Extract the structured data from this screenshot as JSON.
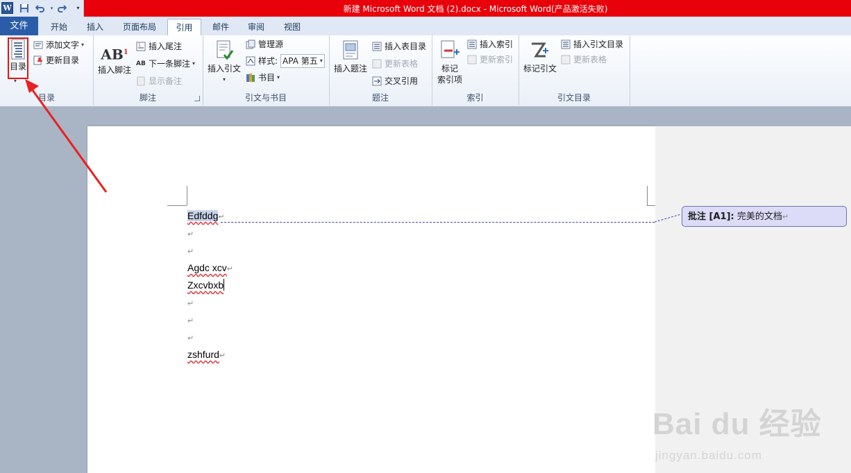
{
  "window": {
    "title": "新建 Microsoft Word 文档 (2).docx  -  Microsoft Word(产品激活失败)",
    "app_logo": "W",
    "accent": "#e8000a"
  },
  "tabs": [
    {
      "label": "文件",
      "name": "tab-file"
    },
    {
      "label": "开始",
      "name": "tab-home"
    },
    {
      "label": "插入",
      "name": "tab-insert"
    },
    {
      "label": "页面布局",
      "name": "tab-page-layout"
    },
    {
      "label": "引用",
      "name": "tab-references",
      "active": true
    },
    {
      "label": "邮件",
      "name": "tab-mailings"
    },
    {
      "label": "审阅",
      "name": "tab-review"
    },
    {
      "label": "视图",
      "name": "tab-view"
    }
  ],
  "ribbon": {
    "toc": {
      "big": "目录",
      "add_text": "添加文字",
      "update": "更新目录",
      "group": "目录"
    },
    "footnote": {
      "insert_footnote": "插入脚注",
      "insert_endnote": "插入尾注",
      "next_footnote": "下一条脚注",
      "show_notes": "显示备注",
      "group": "脚注"
    },
    "citations": {
      "insert_citation": "插入引文",
      "manage_sources": "管理源",
      "style_label": "样式:",
      "style_value": "APA 第五",
      "bibliography": "书目",
      "group": "引文与书目"
    },
    "captions": {
      "insert_caption": "插入题注",
      "insert_table_of_figures": "插入表目录",
      "update_table": "更新表格",
      "cross_reference": "交叉引用",
      "group": "题注"
    },
    "index": {
      "mark_entry_1": "标记",
      "mark_entry_2": "索引项",
      "insert_index": "插入索引",
      "update_index": "更新索引",
      "group": "索引"
    },
    "authorities": {
      "mark_citation": "标记引文",
      "insert_toa": "插入引文目录",
      "update_table": "更新表格",
      "group": "引文目录"
    }
  },
  "document": {
    "lines": [
      "Edfddg",
      "",
      "",
      "Agdc xcv",
      "Zxcvbxb",
      "",
      "",
      "",
      "zshfurd"
    ],
    "paragraph_mark": "↵"
  },
  "comment": {
    "prefix": "批注 [A1]:",
    "text": "完美的文档"
  },
  "watermark": {
    "main": "Bai du 经验",
    "sub": "jingyan.baidu.com"
  }
}
